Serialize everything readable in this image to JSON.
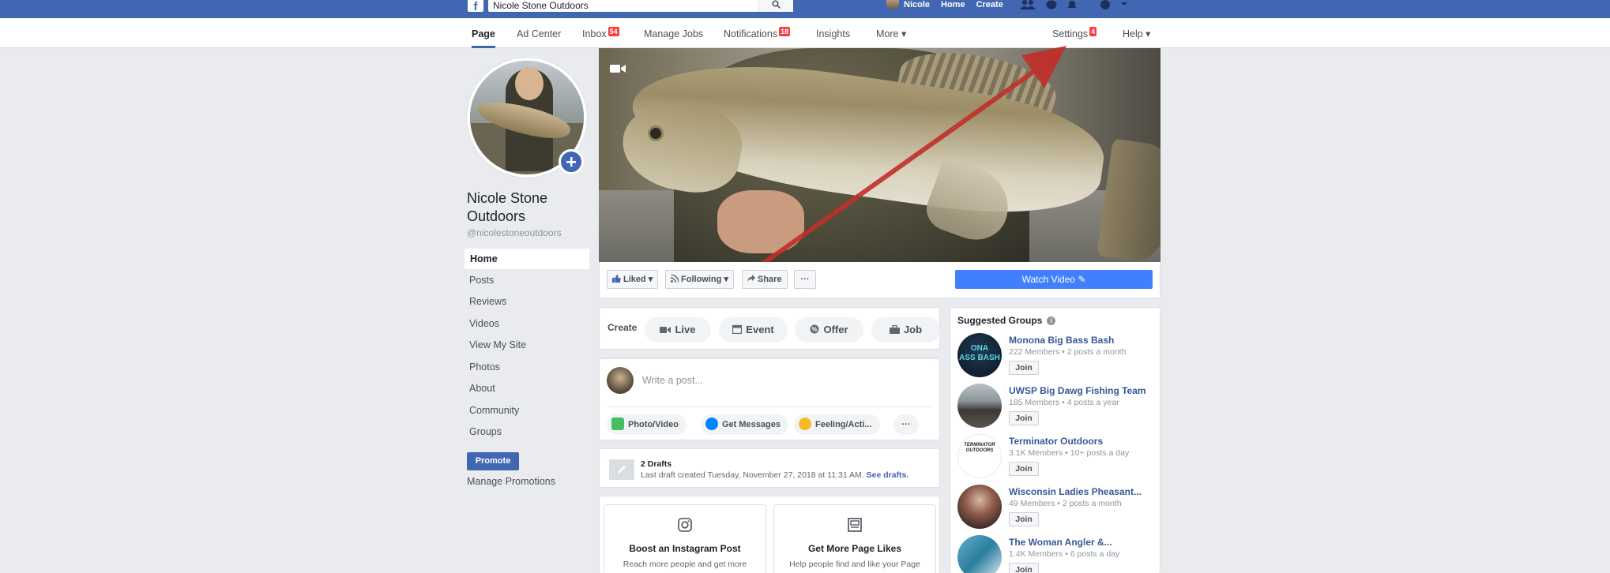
{
  "topbar": {
    "logo": "f",
    "search_value": "Nicole Stone Outdoors",
    "search_icon": "search-icon",
    "user_name": "Nicole",
    "home": "Home",
    "create": "Create",
    "icons": [
      "friends-icon",
      "messenger-icon",
      "bell-icon",
      "help-icon",
      "caret-down-icon"
    ]
  },
  "pagenav": {
    "page": "Page",
    "ad_center": "Ad Center",
    "inbox": "Inbox",
    "inbox_count": "54",
    "manage_jobs": "Manage Jobs",
    "notifications": "Notifications",
    "notifications_count": "18",
    "insights": "Insights",
    "more": "More ▾",
    "settings": "Settings",
    "settings_count": "4",
    "help": "Help ▾"
  },
  "sidebar": {
    "name": "Nicole Stone Outdoors",
    "handle": "@nicolestoneoutdoors",
    "items": [
      {
        "label": "Home"
      },
      {
        "label": "Posts"
      },
      {
        "label": "Reviews"
      },
      {
        "label": "Videos"
      },
      {
        "label": "View My Site"
      },
      {
        "label": "Photos"
      },
      {
        "label": "About"
      },
      {
        "label": "Community"
      },
      {
        "label": "Groups"
      }
    ],
    "promote": "Promote",
    "manage_promotions": "Manage Promotions"
  },
  "actions": {
    "liked": "Liked ▾",
    "following": "Following ▾",
    "share": "Share",
    "more": "···",
    "watch_video": "Watch Video ✎"
  },
  "create": {
    "label": "Create",
    "live": "Live",
    "event": "Event",
    "offer": "Offer",
    "job": "Job"
  },
  "composer": {
    "placeholder": "Write a post...",
    "photo_video": "Photo/Video",
    "get_messages": "Get Messages",
    "feeling": "Feeling/Acti...",
    "more": "···"
  },
  "drafts": {
    "title": "2 Drafts",
    "subtitle": "Last draft created Tuesday, November 27, 2018 at 11:31 AM.",
    "link": "See drafts."
  },
  "promos": [
    {
      "icon": "instagram-icon",
      "title": "Boost an Instagram Post",
      "desc": "Reach more people and get more"
    },
    {
      "icon": "page-likes-icon",
      "title": "Get More Page Likes",
      "desc": "Help people find and like your Page"
    }
  ],
  "suggested_groups": {
    "title": "Suggested Groups",
    "join_label": "Join",
    "items": [
      {
        "name": "Monona Big Bass Bash",
        "meta": "222 Members • 2 posts a month",
        "thumb_text": "ONA\nASS BASH"
      },
      {
        "name": "UWSP Big Dawg Fishing Team",
        "meta": "185 Members • 4 posts a year",
        "thumb_text": ""
      },
      {
        "name": "Terminator Outdoors",
        "meta": "3.1K Members • 10+ posts a day",
        "thumb_text": "TERMINATOR OUTDOORS"
      },
      {
        "name": "Wisconsin Ladies Pheasant...",
        "meta": "49 Members • 2 posts a month",
        "thumb_text": ""
      },
      {
        "name": "The Woman Angler &...",
        "meta": "1.4K Members • 6 posts a day",
        "thumb_text": ""
      }
    ]
  },
  "colors": {
    "brand_blue": "#4267b2",
    "watch_button": "#4080ff",
    "badge_red": "#fa3e3e",
    "link_blue": "#365899",
    "annotation_arrow": "#c0302a"
  }
}
